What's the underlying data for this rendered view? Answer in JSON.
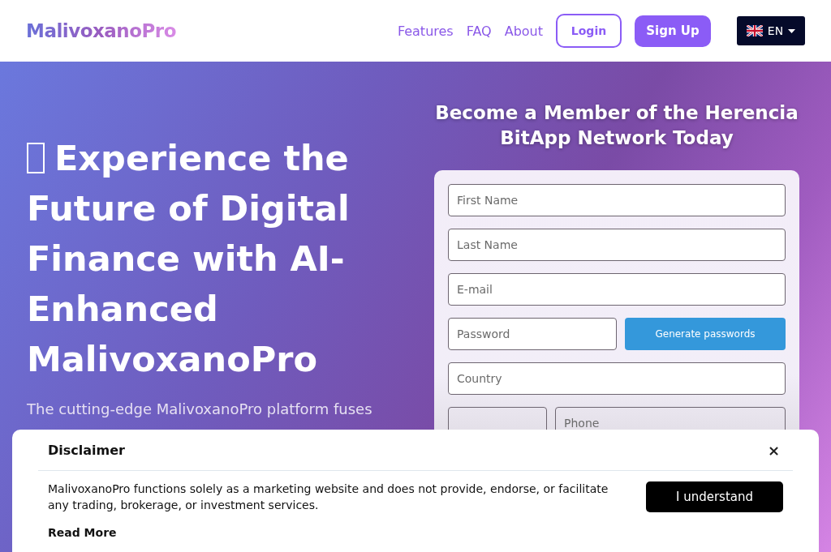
{
  "header": {
    "brand": "MalivoxanoPro",
    "nav": [
      {
        "label": "Features"
      },
      {
        "label": "FAQ"
      },
      {
        "label": "About"
      }
    ],
    "login": "Login",
    "signup": "Sign Up",
    "language": {
      "code": "EN"
    }
  },
  "hero": {
    "heading": "Experience the Future of Digital Finance with AI-Enhanced MalivoxanoPro",
    "lead": "The cutting-edge MalivoxanoPro platform fuses"
  },
  "form": {
    "title": "Become a Member of the Herencia BitApp Network Today",
    "rows": [
      [
        {
          "kind": "input",
          "placeholder": "First Name"
        }
      ],
      [
        {
          "kind": "input",
          "placeholder": "Last Name"
        }
      ],
      [
        {
          "kind": "input",
          "placeholder": "E-mail"
        }
      ],
      [
        {
          "kind": "input",
          "placeholder": "Password"
        },
        {
          "kind": "button",
          "label": "Generate passwords"
        }
      ],
      [
        {
          "kind": "input",
          "placeholder": "Country"
        }
      ],
      [
        {
          "kind": "code"
        },
        {
          "kind": "wide",
          "placeholder": "Phone"
        }
      ]
    ]
  },
  "disclaimer": {
    "title": "Disclaimer",
    "close": "×",
    "text": "MalivoxanoPro functions solely as a marketing website and does not provide, endorse, or facilitate any trading, brokerage, or investment services.",
    "button": "I understand",
    "read_more": "Read More"
  }
}
